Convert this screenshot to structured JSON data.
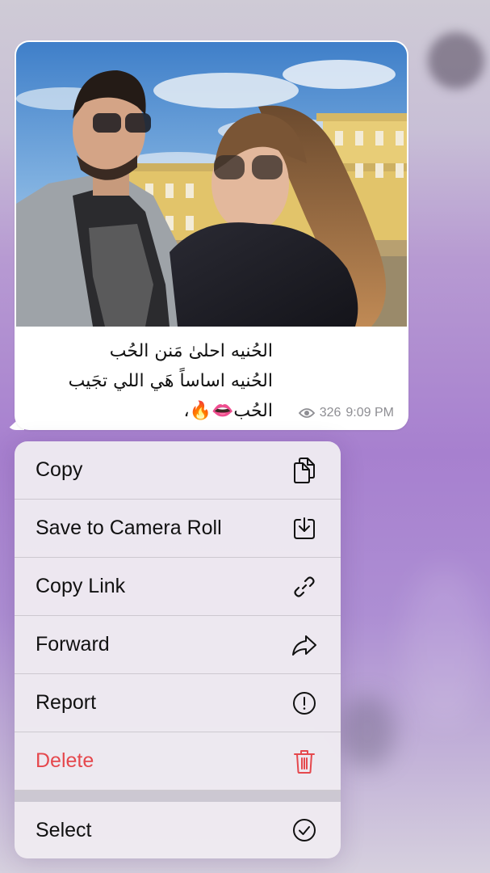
{
  "message": {
    "caption_lines": [
      "الحُنيه احلىٰ مَنن الحُب",
      "الحُنيه اساساً هَي اللي تجَيب",
      "الحُب👄🔥،"
    ],
    "views": "326",
    "time": "9:09 PM",
    "views_icon": "eye-icon"
  },
  "menu": {
    "items": [
      {
        "label": "Copy",
        "icon": "copy-icon"
      },
      {
        "label": "Save to Camera Roll",
        "icon": "download-icon"
      },
      {
        "label": "Copy Link",
        "icon": "link-icon"
      },
      {
        "label": "Forward",
        "icon": "forward-arrow-icon"
      },
      {
        "label": "Report",
        "icon": "exclamation-circle-icon"
      },
      {
        "label": "Delete",
        "icon": "trash-icon"
      },
      {
        "label": "Select",
        "icon": "checkmark-circle-icon"
      }
    ],
    "delete_color": "#e5484d"
  }
}
